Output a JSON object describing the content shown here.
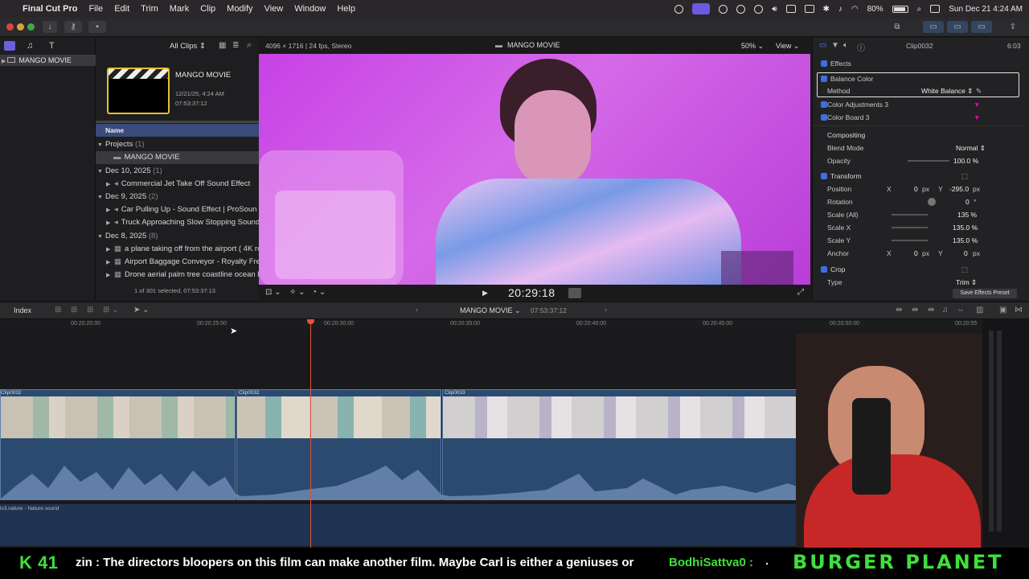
{
  "menubar": {
    "app": "Final Cut Pro",
    "items": [
      "File",
      "Edit",
      "Trim",
      "Mark",
      "Clip",
      "Modify",
      "View",
      "Window",
      "Help"
    ],
    "battery": "80%",
    "datetime": "Sun Dec 21  4:24 AM"
  },
  "browser": {
    "filter": "All Clips",
    "library_name": "MANGO MOVIE",
    "project_thumb": {
      "title": "MANGO MOVIE",
      "date": "12/21/25, 4:24 AM",
      "duration": "07:53:37:12"
    },
    "column_header": "Name",
    "groups": [
      {
        "label": "Projects",
        "count": "(1)",
        "items": [
          "MANGO MOVIE"
        ]
      },
      {
        "label": "Dec 10, 2025",
        "count": "(1)",
        "items": [
          "Commercial Jet Take Off Sound Effect"
        ]
      },
      {
        "label": "Dec 9, 2025",
        "count": "(2)",
        "items": [
          "Car Pulling Up - Sound Effect  |  ProSoun",
          "Truck Approaching Slow Stopping Sound"
        ]
      },
      {
        "label": "Dec 8, 2025",
        "count": "(8)",
        "items": [
          "a plane taking off from the airport ( 4K ro",
          "Airport Baggage Conveyor - Royalty Free",
          "Drone aerial palm tree coastline ocean be"
        ]
      }
    ],
    "status": "1 of 301 selected, 07:53:37:13"
  },
  "viewer": {
    "format": "4096 × 1716 | 24 fps, Stereo",
    "title": "MANGO MOVIE",
    "zoom": "50%",
    "view_label": "View",
    "timecode": "20:29:18"
  },
  "inspector": {
    "clip_name": "Clip0032",
    "clip_duration": "6:03",
    "effects_header": "Effects",
    "balance_color": "Balance Color",
    "method_label": "Method",
    "method_value": "White Balance",
    "color_adjustments": "Color Adjustments 3",
    "color_board": "Color Board 3",
    "compositing": "Compositing",
    "blend_mode_label": "Blend Mode",
    "blend_mode_value": "Normal",
    "opacity_label": "Opacity",
    "opacity_value": "100.0 %",
    "transform": "Transform",
    "position_label": "Position",
    "pos_x_label": "X",
    "pos_x_value": "0",
    "pos_y_label": "Y",
    "pos_y_value": "-295.0",
    "px": "px",
    "rotation_label": "Rotation",
    "rotation_value": "0",
    "degree": "°",
    "scale_all_label": "Scale (All)",
    "scale_all_value": "135 %",
    "scale_x_label": "Scale X",
    "scale_x_value": "135.0 %",
    "scale_y_label": "Scale Y",
    "scale_y_value": "135.0 %",
    "anchor_label": "Anchor",
    "anchor_x_value": "0",
    "anchor_y_value": "0",
    "crop": "Crop",
    "type_label": "Type",
    "type_value": "Trim",
    "save_preset": "Save Effects Preset"
  },
  "timeline": {
    "index_label": "Index",
    "project": "MANGO MOVIE",
    "duration": "07:53:37:12",
    "ruler": [
      "00:20:20:00",
      "00:20:25:00",
      "00:20:30:00",
      "00:20:35:00",
      "00:20:40:00",
      "00:20:45:00",
      "00:20:50:00",
      "00:20:55"
    ],
    "clips": [
      "Clip0032",
      "Clip0032",
      "Clip0033"
    ],
    "audio_clip": "lv3.nature - Nature sound"
  },
  "ticker": {
    "k_count": "K 41",
    "message": "zin : The directors bloopers on this film can make another film. Maybe Carl is either a geniuses or",
    "user": "BodhiSattva0 :",
    "brand": "BURGER PLANET"
  },
  "colors": {
    "accent": "#3d6fe0",
    "magenta_frame": "#c742e6",
    "ticker_green": "#3ee03a",
    "playhead": "#e0553a"
  }
}
